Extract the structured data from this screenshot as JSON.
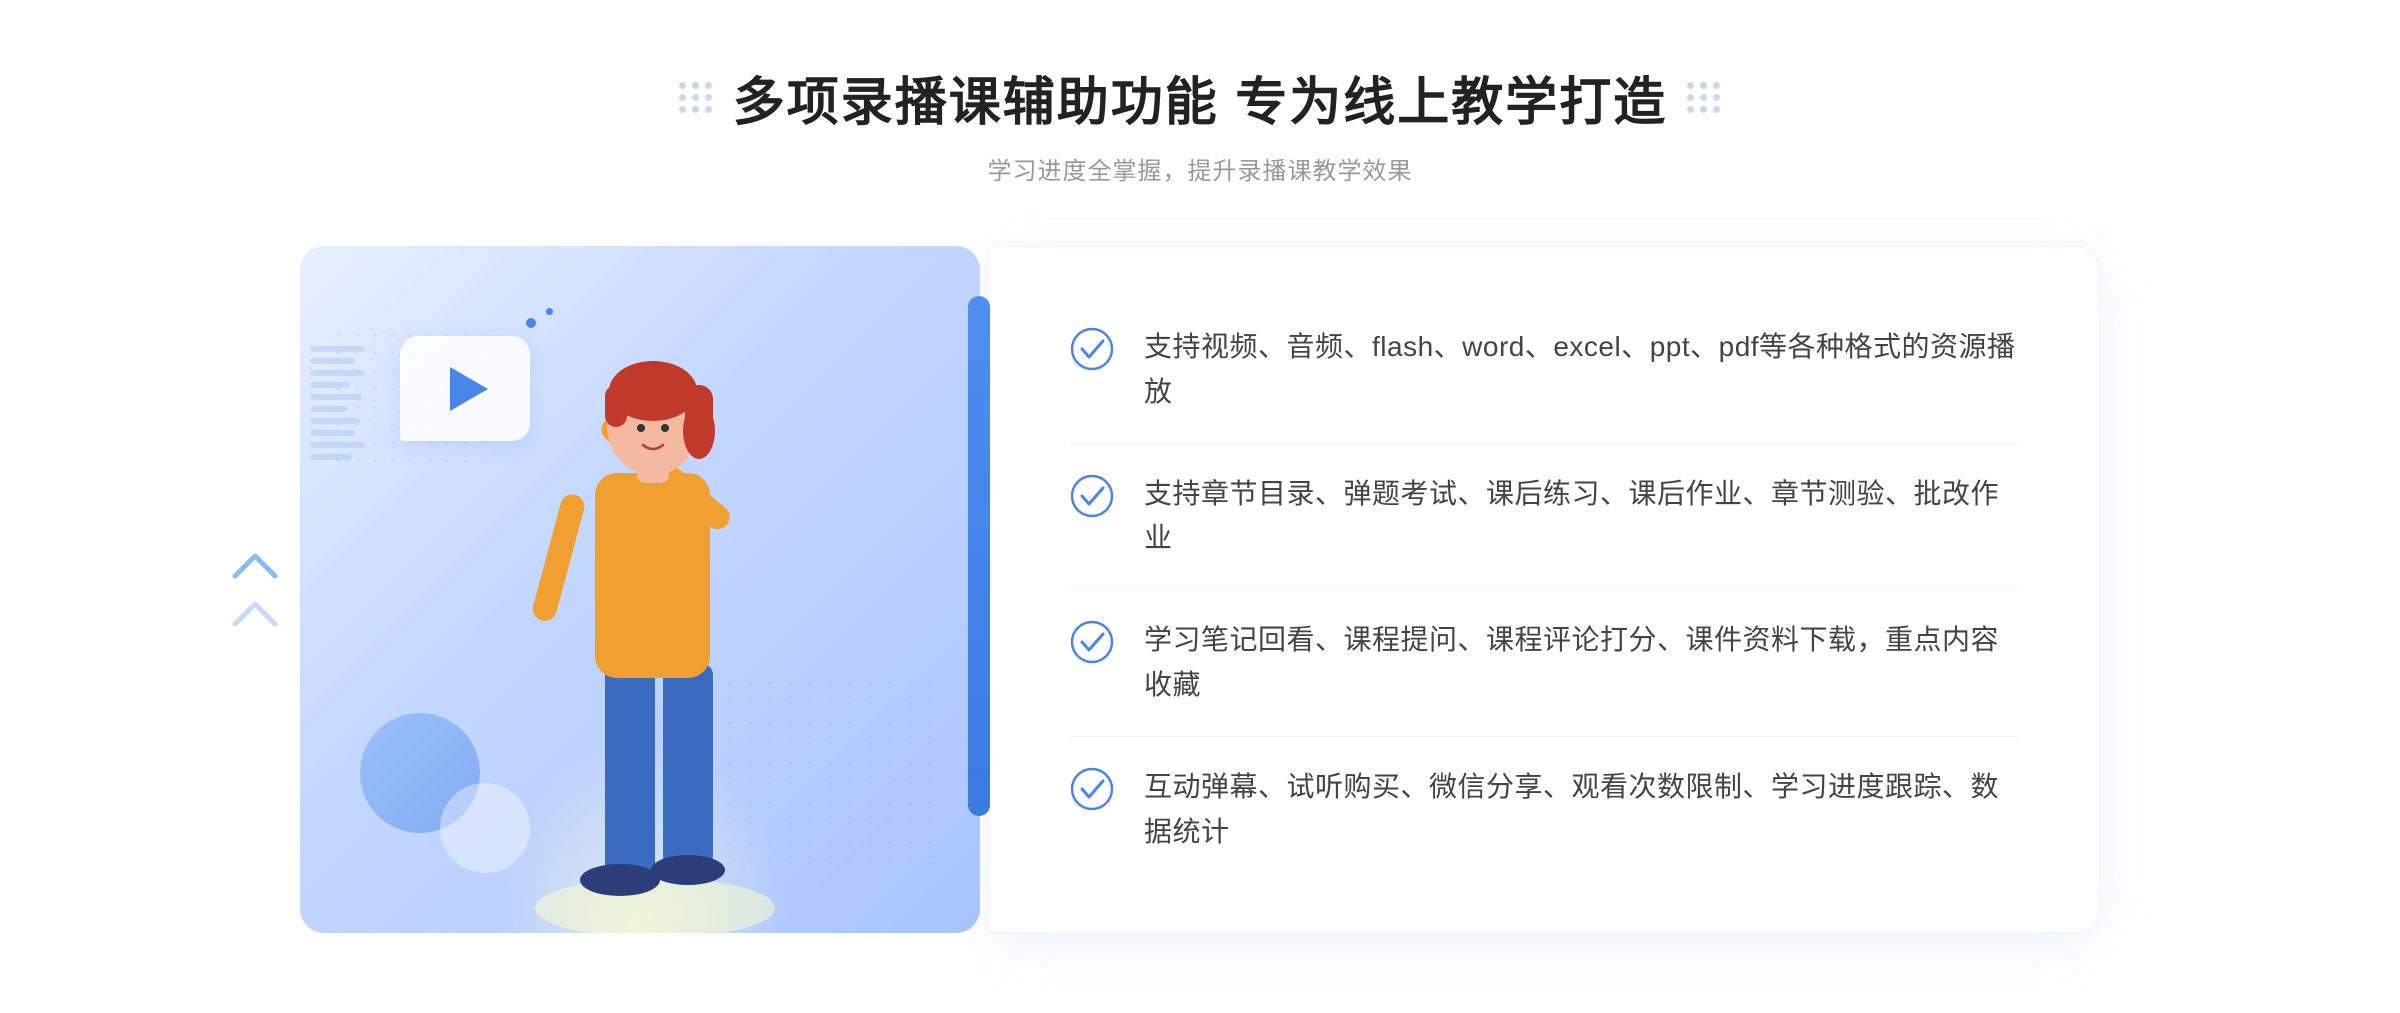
{
  "header": {
    "title": "多项录播课辅助功能 专为线上教学打造",
    "subtitle": "学习进度全掌握，提升录播课教学效果"
  },
  "features": [
    {
      "id": 1,
      "text": "支持视频、音频、flash、word、excel、ppt、pdf等各种格式的资源播放"
    },
    {
      "id": 2,
      "text": "支持章节目录、弹题考试、课后练习、课后作业、章节测验、批改作业"
    },
    {
      "id": 3,
      "text": "学习笔记回看、课程提问、课程评论打分、课件资料下载，重点内容收藏"
    },
    {
      "id": 4,
      "text": "互动弹幕、试听购买、微信分享、观看次数限制、学习进度跟踪、数据统计"
    }
  ],
  "colors": {
    "primary": "#4a85e8",
    "title": "#222222",
    "subtitle": "#999999",
    "feature_text": "#444444",
    "border": "#f0f4ff"
  },
  "icons": {
    "check": "✓",
    "play": "▶",
    "dots_deco": "⠿"
  }
}
